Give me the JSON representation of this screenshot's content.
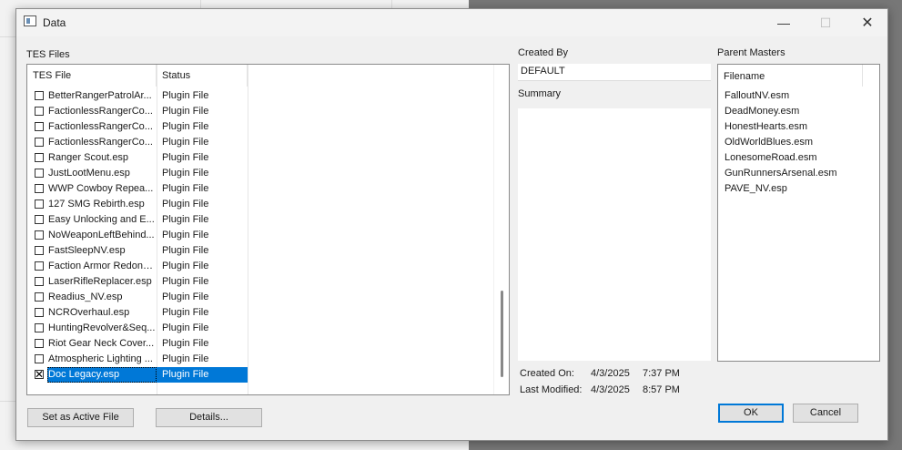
{
  "window": {
    "title": "Data"
  },
  "tes_files": {
    "label": "TES Files",
    "columns": [
      "TES File",
      "Status"
    ],
    "rows": [
      {
        "name": "BetterRangerPatrolAr...",
        "status": "Plugin File",
        "checked": false,
        "selected": false
      },
      {
        "name": "FactionlessRangerCo...",
        "status": "Plugin File",
        "checked": false,
        "selected": false
      },
      {
        "name": "FactionlessRangerCo...",
        "status": "Plugin File",
        "checked": false,
        "selected": false
      },
      {
        "name": "FactionlessRangerCo...",
        "status": "Plugin File",
        "checked": false,
        "selected": false
      },
      {
        "name": "Ranger Scout.esp",
        "status": "Plugin File",
        "checked": false,
        "selected": false
      },
      {
        "name": "JustLootMenu.esp",
        "status": "Plugin File",
        "checked": false,
        "selected": false
      },
      {
        "name": "WWP Cowboy Repea...",
        "status": "Plugin File",
        "checked": false,
        "selected": false
      },
      {
        "name": "127 SMG Rebirth.esp",
        "status": "Plugin File",
        "checked": false,
        "selected": false
      },
      {
        "name": "Easy Unlocking and E...",
        "status": "Plugin File",
        "checked": false,
        "selected": false
      },
      {
        "name": "NoWeaponLeftBehind...",
        "status": "Plugin File",
        "checked": false,
        "selected": false
      },
      {
        "name": "FastSleepNV.esp",
        "status": "Plugin File",
        "checked": false,
        "selected": false
      },
      {
        "name": "Faction Armor Redone...",
        "status": "Plugin File",
        "checked": false,
        "selected": false
      },
      {
        "name": "LaserRifleReplacer.esp",
        "status": "Plugin File",
        "checked": false,
        "selected": false
      },
      {
        "name": "Readius_NV.esp",
        "status": "Plugin File",
        "checked": false,
        "selected": false
      },
      {
        "name": "NCROverhaul.esp",
        "status": "Plugin File",
        "checked": false,
        "selected": false
      },
      {
        "name": "HuntingRevolver&Seq...",
        "status": "Plugin File",
        "checked": false,
        "selected": false
      },
      {
        "name": "Riot Gear Neck Cover...",
        "status": "Plugin File",
        "checked": false,
        "selected": false
      },
      {
        "name": "Atmospheric Lighting ...",
        "status": "Plugin File",
        "checked": false,
        "selected": false
      },
      {
        "name": "Doc Legacy.esp",
        "status": "Plugin File",
        "checked": true,
        "selected": true
      }
    ]
  },
  "created_by": {
    "label": "Created By",
    "value": "DEFAULT"
  },
  "summary": {
    "label": "Summary",
    "value": ""
  },
  "created_on": {
    "label": "Created On:",
    "date": "4/3/2025",
    "time": "7:37 PM"
  },
  "last_modified": {
    "label": "Last Modified:",
    "date": "4/3/2025",
    "time": "8:57 PM"
  },
  "parent_masters": {
    "label": "Parent Masters",
    "column": "Filename",
    "items": [
      "FalloutNV.esm",
      "DeadMoney.esm",
      "HonestHearts.esm",
      "OldWorldBlues.esm",
      "LonesomeRoad.esm",
      "GunRunnersArsenal.esm",
      "PAVE_NV.esp"
    ]
  },
  "buttons": {
    "set_active": "Set as Active File",
    "details": "Details...",
    "ok": "OK",
    "cancel": "Cancel"
  },
  "colors": {
    "selection": "#0078d7",
    "dialog_bg": "#f0f0f0"
  }
}
